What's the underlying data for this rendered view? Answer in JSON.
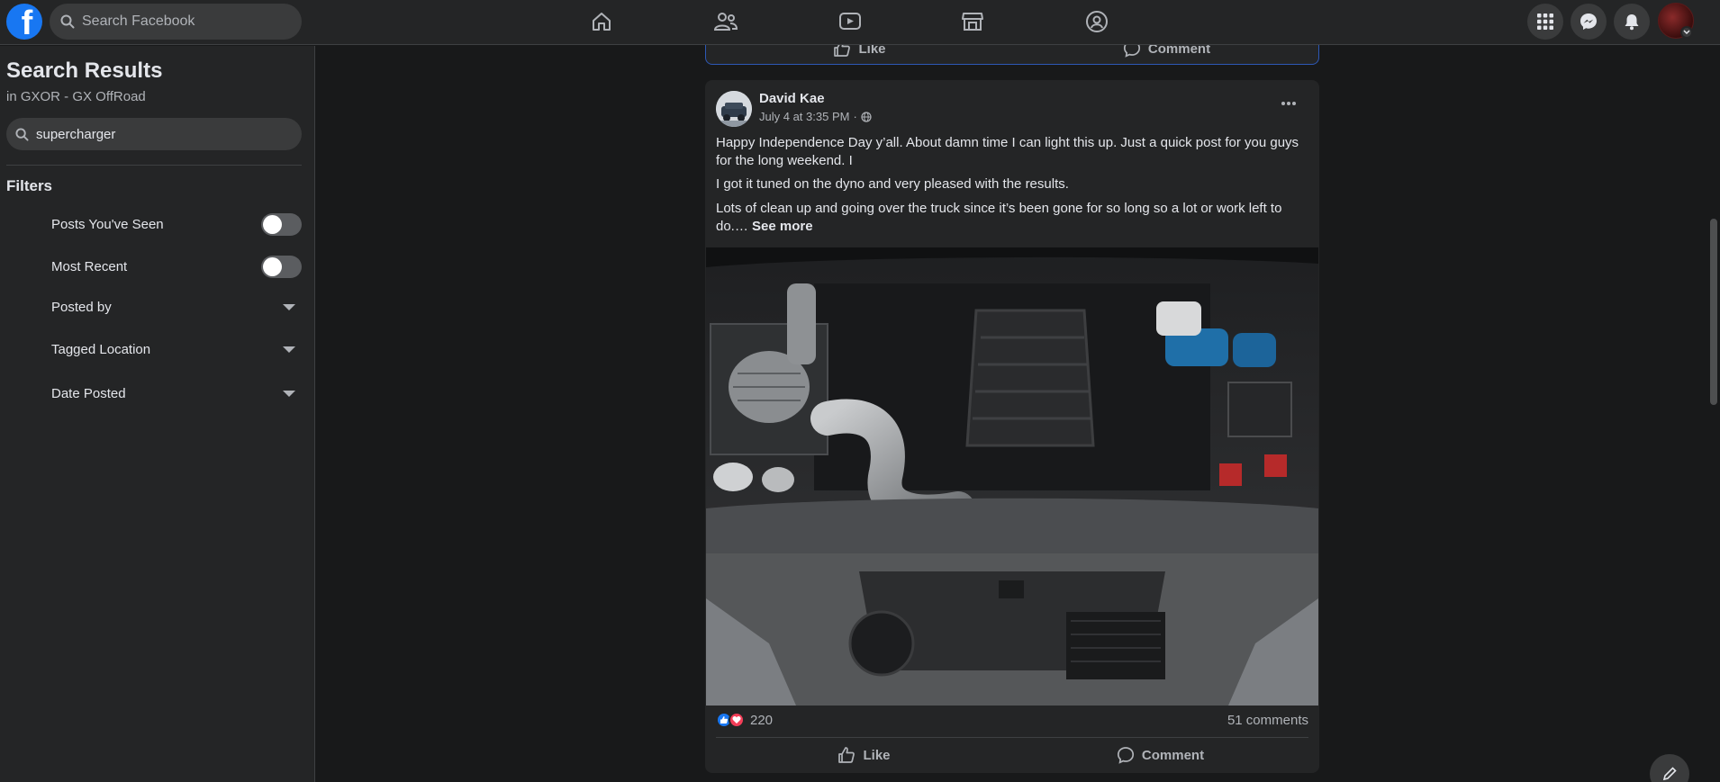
{
  "header": {
    "search_placeholder": "Search Facebook",
    "nav": [
      "home-icon",
      "friends-icon",
      "watch-icon",
      "marketplace-icon",
      "groups-icon"
    ],
    "right_buttons": [
      "menu-grid-icon",
      "messenger-icon",
      "notifications-icon",
      "account-avatar"
    ],
    "accent_color": "#1877f2"
  },
  "sidebar": {
    "title": "Search Results",
    "subtitle": "in GXOR - GX OffRoad",
    "query": "supercharger",
    "filters_heading": "Filters",
    "filters": [
      {
        "label": "Posts You've Seen",
        "kind": "toggle",
        "on": false
      },
      {
        "label": "Most Recent",
        "kind": "toggle",
        "on": false
      },
      {
        "label": "Posted by",
        "kind": "dropdown"
      },
      {
        "label": "Tagged Location",
        "kind": "dropdown"
      },
      {
        "label": "Date Posted",
        "kind": "dropdown"
      }
    ]
  },
  "previous_post": {
    "like_label": "Like",
    "comment_label": "Comment"
  },
  "post": {
    "author": "David Kae",
    "timestamp": "July 4 at 3:35 PM",
    "audience_icon": "globe-icon",
    "paragraphs": [
      "Happy Independence Day y’all. About damn time I can light this up. Just a quick post for you guys for the long weekend. I",
      "I got it tuned on the dyno and very pleased with the results.",
      "Lots of clean up and going over the truck since it’s been gone for so long so a lot or work left to do.…"
    ],
    "see_more": "See more",
    "photo_alt": "engine-bay-photo",
    "reaction_count": "220",
    "comments": "51 comments",
    "like_label": "Like",
    "comment_label": "Comment"
  }
}
